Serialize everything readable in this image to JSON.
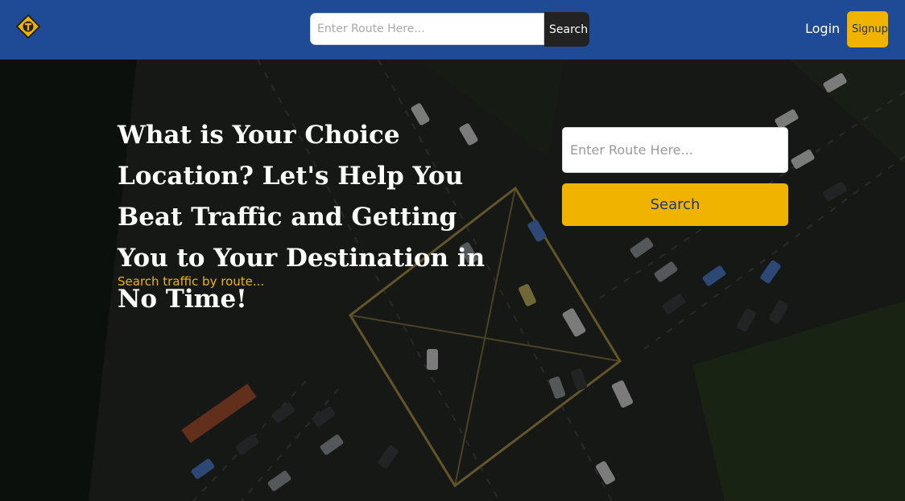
{
  "header": {
    "logo_icon": "traffic-sign-logo",
    "search": {
      "placeholder": "Enter Route Here...",
      "button_label": "Search"
    },
    "login_label": "Login",
    "signup_label": "Signup"
  },
  "hero": {
    "headline": "What is Your Choice Location? Let's Help You Beat Traffic and Getting You to Your Destination in No Time!",
    "subtitle": "Search traffic by route...",
    "search": {
      "placeholder": "Enter Route Here...",
      "button_label": "Search"
    }
  },
  "colors": {
    "nav_bg": "#1f4a95",
    "accent": "#f0b400",
    "dark_button": "#222222"
  }
}
